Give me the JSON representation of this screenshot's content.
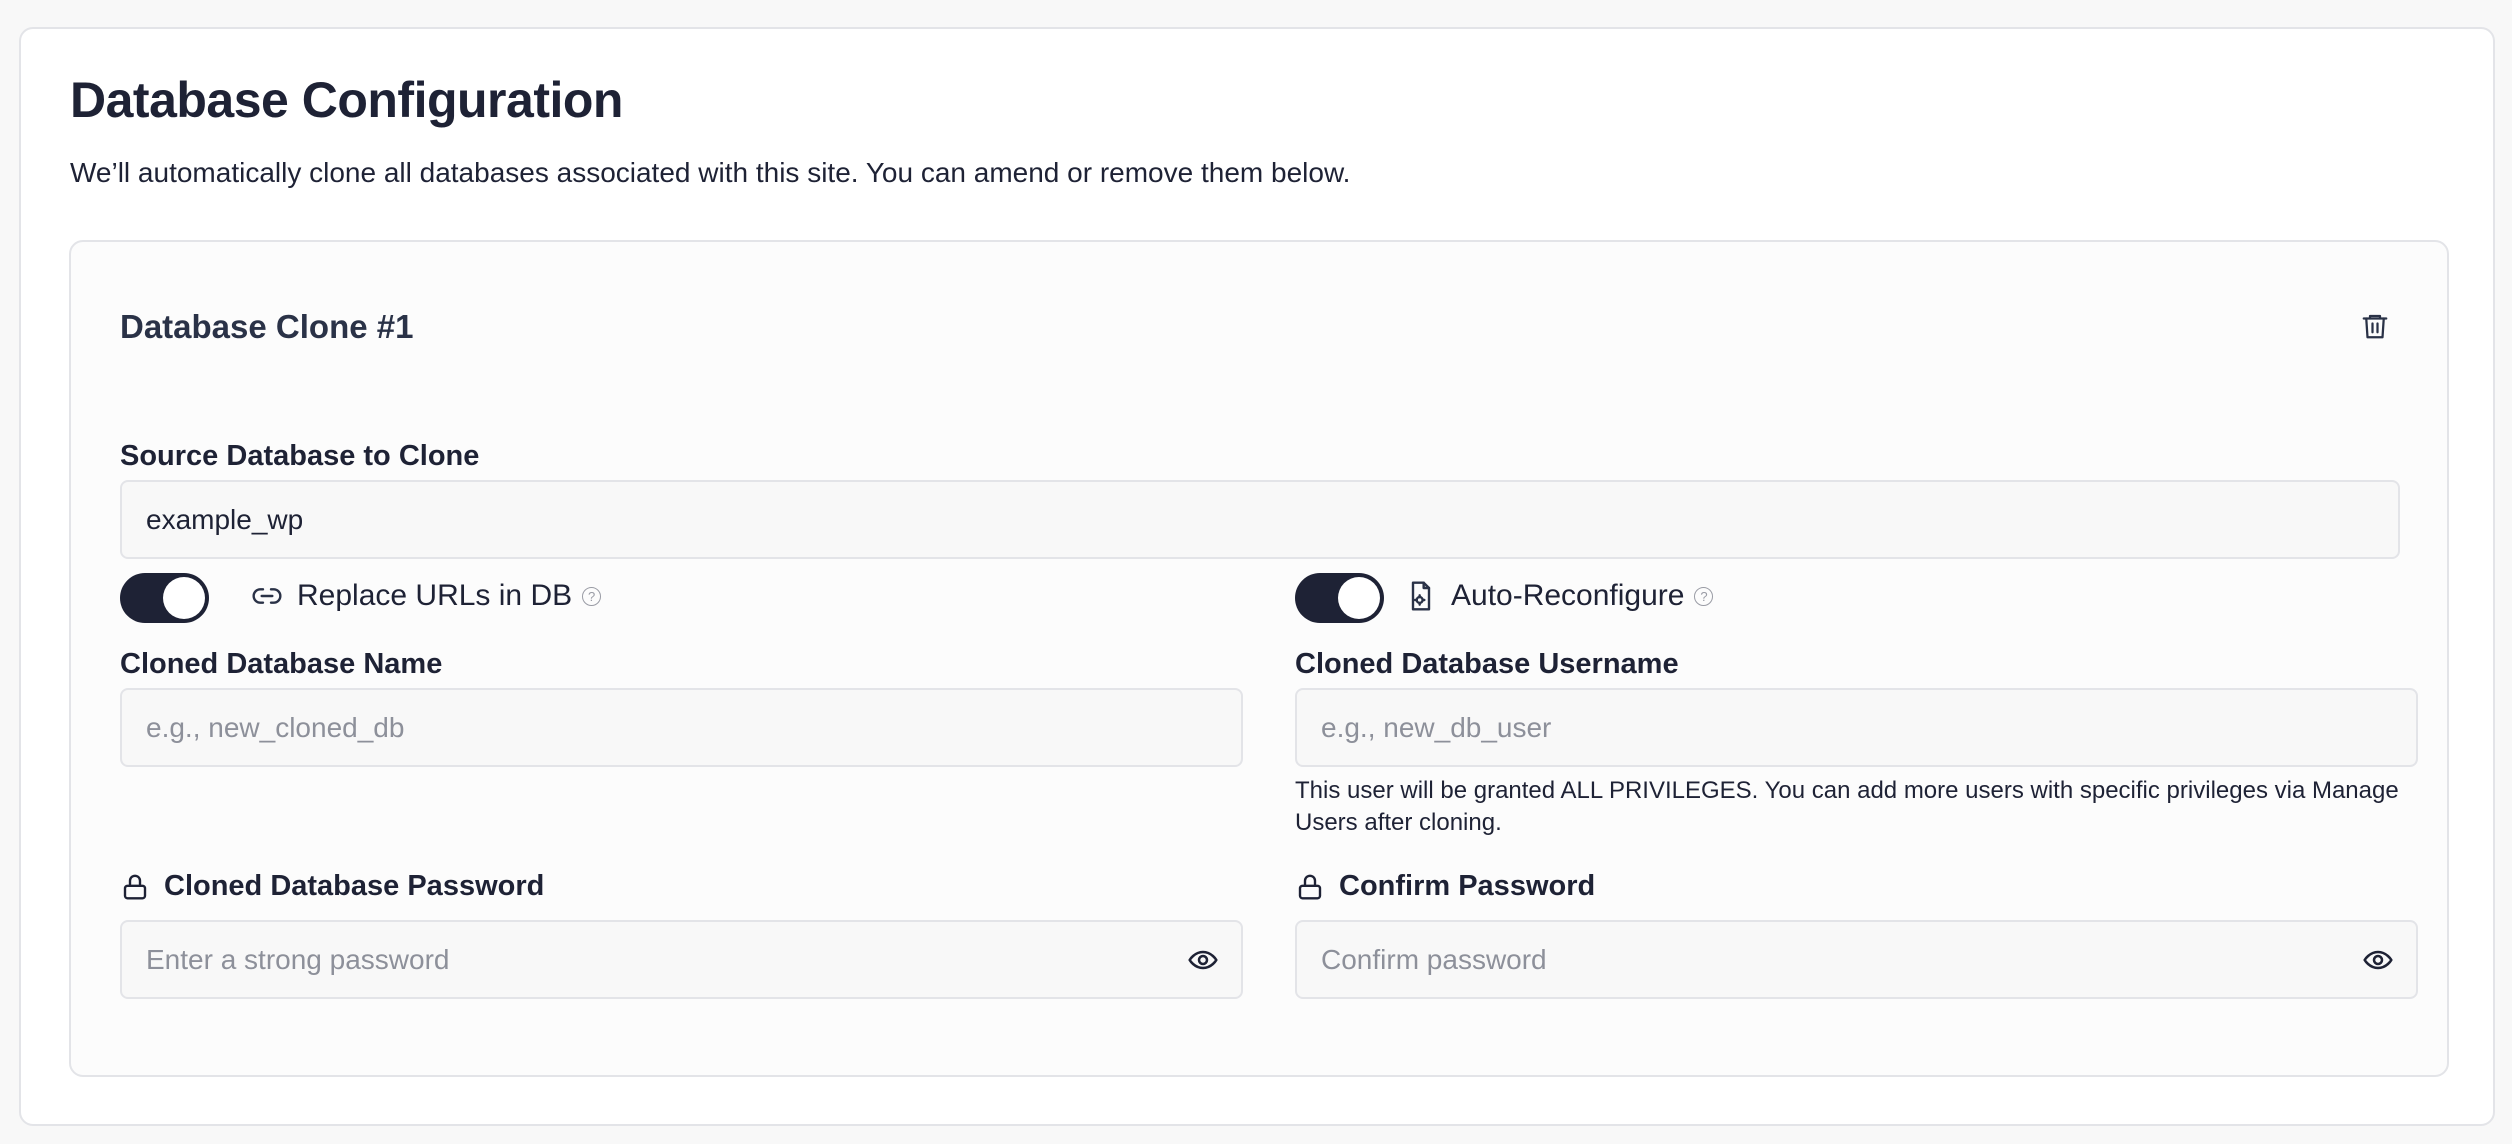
{
  "page": {
    "title": "Database Configuration",
    "subtitle": "We’ll automatically clone all databases associated with this site. You can amend or remove them below."
  },
  "clone": {
    "title": "Database Clone #1",
    "source_label": "Source Database to Clone",
    "source_value": "example_wp",
    "replace_urls": {
      "label": "Replace URLs in DB",
      "enabled": true
    },
    "auto_reconfigure": {
      "label": "Auto-Reconfigure",
      "enabled": true
    },
    "name_label": "Cloned Database Name",
    "name_placeholder": "e.g., new_cloned_db",
    "username_label": "Cloned Database Username",
    "username_placeholder": "e.g., new_db_user",
    "username_hint": "This user will be granted ALL PRIVILEGES. You can add more users with specific privileges via Manage Users after cloning.",
    "password_label": "Cloned Database Password",
    "password_placeholder": "Enter a strong password",
    "confirm_label": "Confirm Password",
    "confirm_placeholder": "Confirm password",
    "help_glyph": "?"
  },
  "icons": {
    "delete": "trash-icon",
    "replace_urls": "link-icon",
    "auto_reconfigure": "file-gear-icon",
    "password": "lock-icon",
    "show_password": "eye-icon"
  },
  "colors": {
    "text": "#1e2235",
    "toggle_on": "#1e2235",
    "border": "#e3e4e8",
    "placeholder": "#8d909a"
  }
}
